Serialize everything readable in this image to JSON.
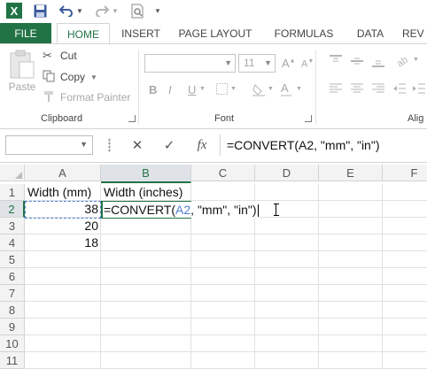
{
  "colors": {
    "accent": "#217346",
    "ref_blue": "#4e7fd6"
  },
  "quick_access": {
    "icons": [
      "excel-logo-icon",
      "save-icon",
      "undo-icon",
      "undo-dropdown-icon",
      "redo-icon",
      "redo-dropdown-icon",
      "print-preview-icon",
      "customize-qat-icon"
    ]
  },
  "tabs": [
    "FILE",
    "HOME",
    "INSERT",
    "PAGE LAYOUT",
    "FORMULAS",
    "DATA",
    "REV"
  ],
  "ribbon": {
    "clipboard": {
      "paste": "Paste",
      "cut": "Cut",
      "copy": "Copy",
      "format_painter": "Format Painter",
      "label": "Clipboard"
    },
    "font": {
      "font_name": "",
      "font_size": "11",
      "bold": "B",
      "italic": "I",
      "underline": "U",
      "font_color": "A",
      "label": "Font"
    },
    "alignment": {
      "label": "Alig"
    }
  },
  "formula_bar": {
    "name_box": "",
    "cancel": "✕",
    "enter": "✓",
    "fx": "fx",
    "formula": "=CONVERT(A2, \"mm\", \"in\")"
  },
  "grid": {
    "columns": [
      "A",
      "B",
      "C",
      "D",
      "E",
      "F"
    ],
    "selected_column": "B",
    "rows": [
      "1",
      "2",
      "3",
      "4",
      "5",
      "6",
      "7",
      "8",
      "9",
      "10",
      "11"
    ],
    "selected_row": "2",
    "cells": {
      "A1": "Width (mm)",
      "B1": "Width (inches)",
      "A2": "38",
      "A3": "20",
      "A4": "18"
    },
    "edit": {
      "prefix": "=CONVERT(",
      "ref": "A2",
      "suffix": ", \"mm\", \"in\")"
    }
  }
}
